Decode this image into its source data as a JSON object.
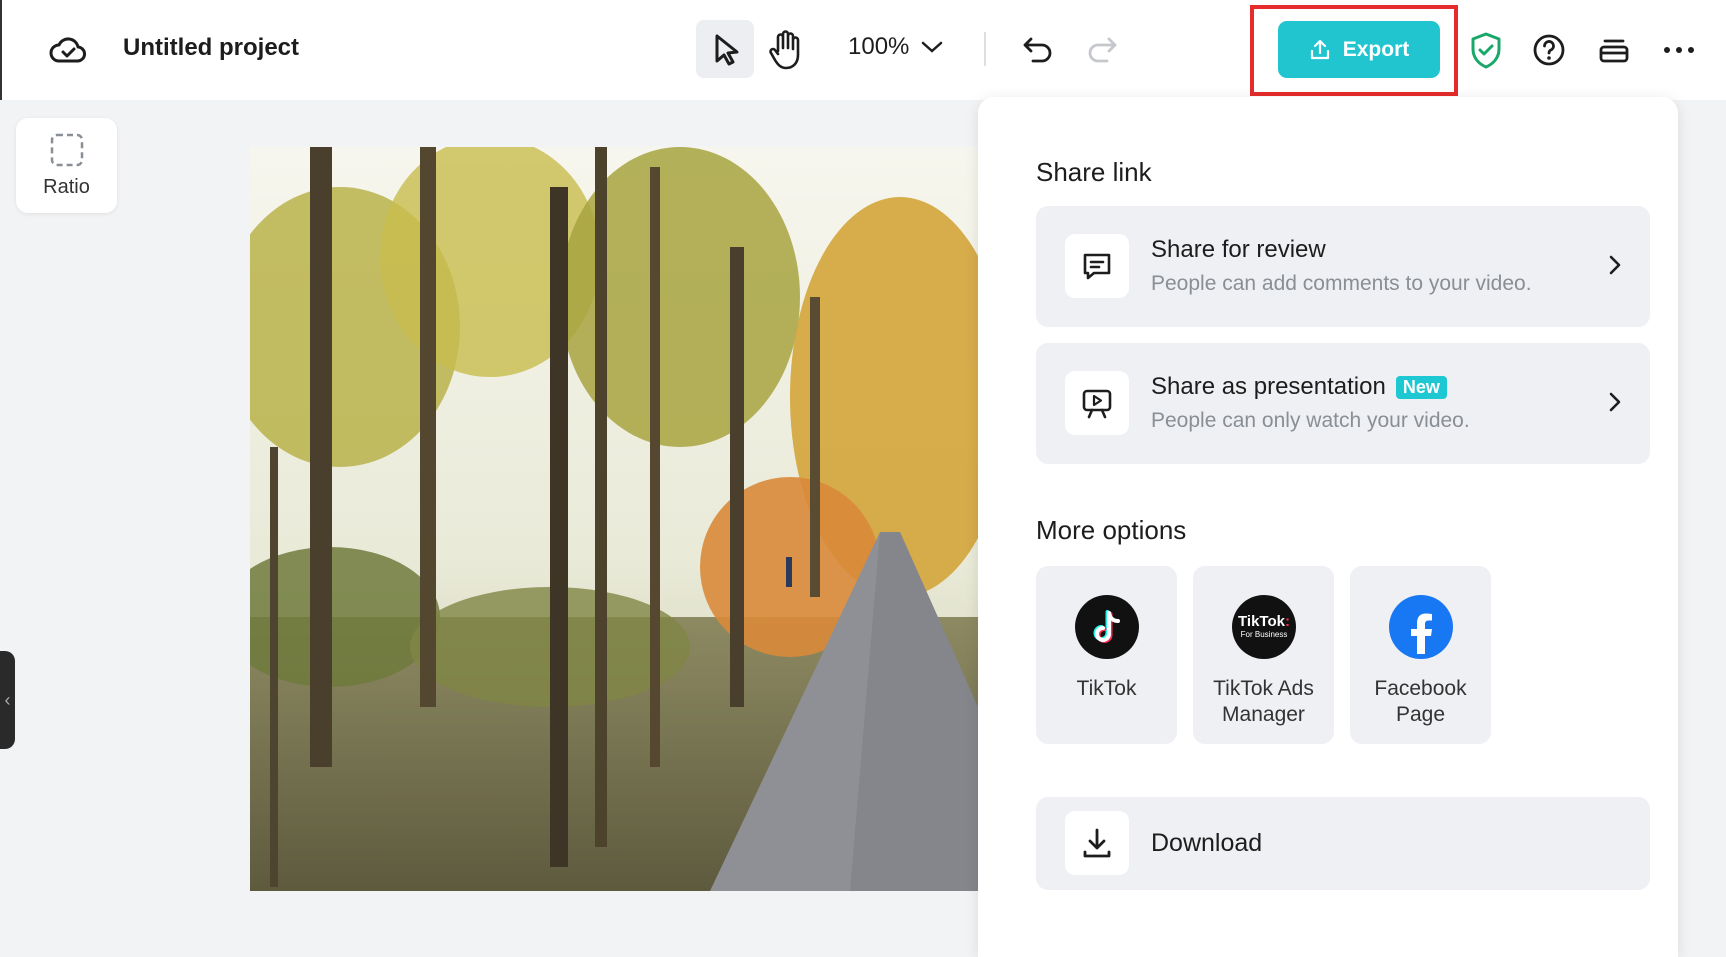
{
  "header": {
    "project_title": "Untitled project",
    "zoom_level": "100%",
    "export_label": "Export"
  },
  "sidebar": {
    "ratio_label": "Ratio"
  },
  "share_panel": {
    "share_link_title": "Share link",
    "share_review": {
      "title": "Share for review",
      "subtitle": "People can add comments to your video."
    },
    "share_presentation": {
      "title": "Share as presentation",
      "badge": "New",
      "subtitle": "People can only watch your video."
    },
    "more_options_title": "More options",
    "options": [
      {
        "label_line1": "TikTok",
        "label_line2": "",
        "logo_text": ""
      },
      {
        "label_line1": "TikTok Ads",
        "label_line2": "Manager",
        "logo_text": "TikTok:",
        "logo_sub": "For Business"
      },
      {
        "label_line1": "Facebook",
        "label_line2": "Page",
        "logo_text": ""
      }
    ],
    "download_label": "Download"
  },
  "colors": {
    "accent": "#20c5cf",
    "highlight": "#e52b2b",
    "shield": "#1aa86a",
    "facebook": "#1877f2"
  }
}
